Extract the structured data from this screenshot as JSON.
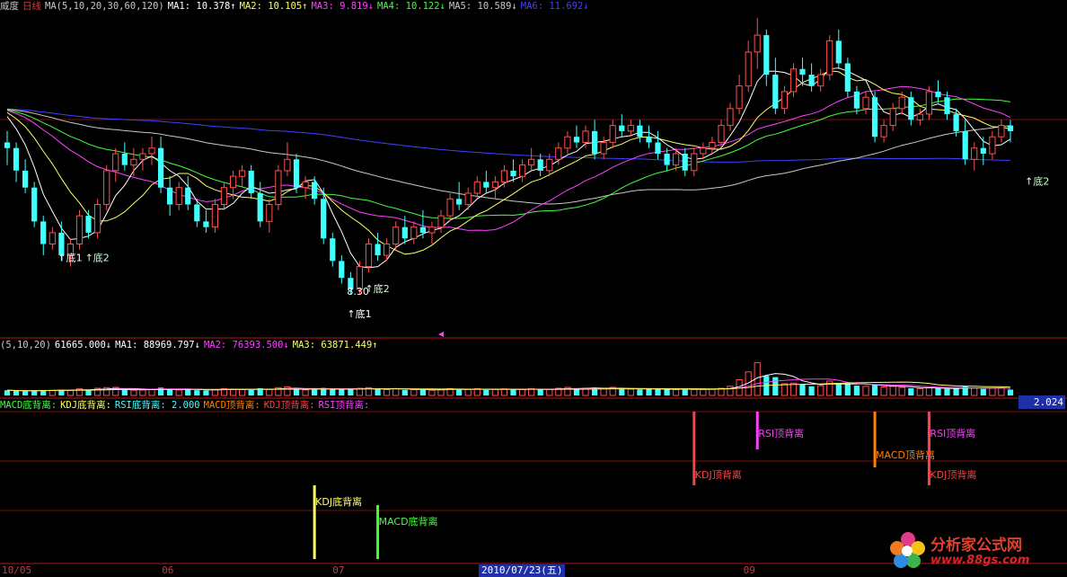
{
  "main_legend": [
    {
      "text": "威度",
      "color": "#c8c8c8"
    },
    {
      "text": "日线",
      "color": "#e83030"
    },
    {
      "text": "MA(5,10,20,30,60,120)",
      "color": "#c8c8c8"
    },
    {
      "text": "MA1: 10.378↑",
      "color": "#ffffff"
    },
    {
      "text": "MA2: 10.105↑",
      "color": "#ffff60"
    },
    {
      "text": "MA3: 9.819↓",
      "color": "#ff40ff"
    },
    {
      "text": "MA4: 10.122↓",
      "color": "#40ff40"
    },
    {
      "text": "MA5: 10.589↓",
      "color": "#c8c8c8"
    },
    {
      "text": "MA6: 11.692↓",
      "color": "#4040ff"
    }
  ],
  "vol_legend": [
    {
      "text": "(5,10,20)",
      "color": "#c8c8c8"
    },
    {
      "text": "61665.000↓",
      "color": "#ffffff"
    },
    {
      "text": "MA1: 88969.797↓",
      "color": "#ffffff"
    },
    {
      "text": "MA2: 76393.500↓",
      "color": "#ff40ff"
    },
    {
      "text": "MA3: 63871.449↑",
      "color": "#ffff60"
    }
  ],
  "sig_legend": [
    {
      "text": "MACD底背离:",
      "color": "#40ff40"
    },
    {
      "text": "KDJ底背离:",
      "color": "#ffff60"
    },
    {
      "text": "RSI底背离: 2.000",
      "color": "#40ffff"
    },
    {
      "text": "MACD顶背离:",
      "color": "#ff8000"
    },
    {
      "text": "KDJ顶背离:",
      "color": "#ff4040"
    },
    {
      "text": "RSI顶背离:",
      "color": "#ff40ff"
    }
  ],
  "signal_value": "2.024",
  "date_ticks": [
    {
      "label": "10/05",
      "pos": 0.0
    },
    {
      "label": "06",
      "pos": 0.15
    },
    {
      "label": "07",
      "pos": 0.31
    },
    {
      "label": "09",
      "pos": 0.695
    }
  ],
  "current_date": "2010/07/23(五)",
  "watermark": {
    "title": "分析家公式网",
    "url": "www.88gs.com"
  },
  "chart_data": {
    "type": "candlestick",
    "price_range": [
      7.6,
      13.3
    ],
    "annotations": [
      {
        "text": "底1",
        "index": 6,
        "price": 8.9
      },
      {
        "text": "底2",
        "index": 9,
        "price": 8.9
      },
      {
        "text": "底1",
        "index": 38,
        "price": 7.9
      },
      {
        "text": "底2",
        "index": 40,
        "price": 8.35
      },
      {
        "text": "底2",
        "index": 113,
        "price": 10.25
      },
      {
        "text": "8.30",
        "index": 38,
        "price": 8.3
      }
    ],
    "candles": [
      [
        11.0,
        11.2,
        10.6,
        10.9
      ],
      [
        10.9,
        11.0,
        10.3,
        10.5
      ],
      [
        10.5,
        10.7,
        10.1,
        10.2
      ],
      [
        10.2,
        10.3,
        9.5,
        9.6
      ],
      [
        9.6,
        9.7,
        9.0,
        9.2
      ],
      [
        9.2,
        9.5,
        9.1,
        9.4
      ],
      [
        9.4,
        9.6,
        8.9,
        9.0
      ],
      [
        9.0,
        9.3,
        8.8,
        9.2
      ],
      [
        9.2,
        9.8,
        9.1,
        9.7
      ],
      [
        9.7,
        9.8,
        9.3,
        9.4
      ],
      [
        9.4,
        10.0,
        9.3,
        9.9
      ],
      [
        9.9,
        10.6,
        9.8,
        10.5
      ],
      [
        10.5,
        10.9,
        10.3,
        10.8
      ],
      [
        10.8,
        11.0,
        10.5,
        10.6
      ],
      [
        10.6,
        10.9,
        10.4,
        10.7
      ],
      [
        10.7,
        10.9,
        10.5,
        10.8
      ],
      [
        10.8,
        11.1,
        10.6,
        10.9
      ],
      [
        10.9,
        11.1,
        10.1,
        10.2
      ],
      [
        10.2,
        10.4,
        9.7,
        9.9
      ],
      [
        9.9,
        10.3,
        9.8,
        10.2
      ],
      [
        10.2,
        10.4,
        9.8,
        9.9
      ],
      [
        9.9,
        10.0,
        9.5,
        9.6
      ],
      [
        9.6,
        9.8,
        9.4,
        9.5
      ],
      [
        9.5,
        10.0,
        9.4,
        9.9
      ],
      [
        9.9,
        10.3,
        9.8,
        10.2
      ],
      [
        10.2,
        10.5,
        10.0,
        10.4
      ],
      [
        10.4,
        10.6,
        10.2,
        10.5
      ],
      [
        10.5,
        10.6,
        10.0,
        10.1
      ],
      [
        10.1,
        10.3,
        9.5,
        9.6
      ],
      [
        9.6,
        10.0,
        9.4,
        9.9
      ],
      [
        9.9,
        10.6,
        9.8,
        10.5
      ],
      [
        10.5,
        11.0,
        10.4,
        10.7
      ],
      [
        10.7,
        10.8,
        10.1,
        10.2
      ],
      [
        10.2,
        10.4,
        10.0,
        10.3
      ],
      [
        10.3,
        10.4,
        9.9,
        10.0
      ],
      [
        10.0,
        10.2,
        9.2,
        9.3
      ],
      [
        9.3,
        9.4,
        8.8,
        8.9
      ],
      [
        8.9,
        9.0,
        8.5,
        8.6
      ],
      [
        8.6,
        8.7,
        8.3,
        8.4
      ],
      [
        8.4,
        8.9,
        8.3,
        8.8
      ],
      [
        8.8,
        9.3,
        8.7,
        9.2
      ],
      [
        9.2,
        9.4,
        8.9,
        9.0
      ],
      [
        9.0,
        9.3,
        8.9,
        9.2
      ],
      [
        9.2,
        9.6,
        9.1,
        9.5
      ],
      [
        9.5,
        9.7,
        9.2,
        9.3
      ],
      [
        9.3,
        9.6,
        9.2,
        9.5
      ],
      [
        9.5,
        9.8,
        9.3,
        9.4
      ],
      [
        9.4,
        9.6,
        9.2,
        9.5
      ],
      [
        9.5,
        9.8,
        9.4,
        9.7
      ],
      [
        9.7,
        10.1,
        9.6,
        10.0
      ],
      [
        10.0,
        10.3,
        9.8,
        9.9
      ],
      [
        9.9,
        10.2,
        9.8,
        10.1
      ],
      [
        10.1,
        10.4,
        10.0,
        10.3
      ],
      [
        10.3,
        10.5,
        10.1,
        10.2
      ],
      [
        10.2,
        10.4,
        10.0,
        10.3
      ],
      [
        10.3,
        10.6,
        10.2,
        10.5
      ],
      [
        10.5,
        10.7,
        10.3,
        10.4
      ],
      [
        10.4,
        10.7,
        10.3,
        10.6
      ],
      [
        10.6,
        10.9,
        10.5,
        10.7
      ],
      [
        10.7,
        10.8,
        10.4,
        10.5
      ],
      [
        10.5,
        10.8,
        10.4,
        10.7
      ],
      [
        10.7,
        11.0,
        10.6,
        10.9
      ],
      [
        10.9,
        11.2,
        10.8,
        11.1
      ],
      [
        11.1,
        11.3,
        10.9,
        11.0
      ],
      [
        11.0,
        11.3,
        10.9,
        11.2
      ],
      [
        11.2,
        11.4,
        10.7,
        10.8
      ],
      [
        10.8,
        11.1,
        10.7,
        11.0
      ],
      [
        11.0,
        11.4,
        10.9,
        11.3
      ],
      [
        11.3,
        11.5,
        11.1,
        11.2
      ],
      [
        11.2,
        11.4,
        11.1,
        11.3
      ],
      [
        11.3,
        11.4,
        11.0,
        11.1
      ],
      [
        11.1,
        11.3,
        10.9,
        11.0
      ],
      [
        11.0,
        11.2,
        10.7,
        10.8
      ],
      [
        10.8,
        10.9,
        10.5,
        10.6
      ],
      [
        10.6,
        10.9,
        10.5,
        10.8
      ],
      [
        10.8,
        10.9,
        10.4,
        10.5
      ],
      [
        10.5,
        10.9,
        10.4,
        10.8
      ],
      [
        10.8,
        11.0,
        10.7,
        10.9
      ],
      [
        10.9,
        11.1,
        10.8,
        11.0
      ],
      [
        11.0,
        11.4,
        10.9,
        11.3
      ],
      [
        11.3,
        11.7,
        11.2,
        11.6
      ],
      [
        11.6,
        12.2,
        11.5,
        12.0
      ],
      [
        12.0,
        12.8,
        11.9,
        12.6
      ],
      [
        12.6,
        13.2,
        12.3,
        12.9
      ],
      [
        12.9,
        13.0,
        12.0,
        12.2
      ],
      [
        12.2,
        12.5,
        11.5,
        11.6
      ],
      [
        11.6,
        12.0,
        11.5,
        11.9
      ],
      [
        11.9,
        12.4,
        11.8,
        12.3
      ],
      [
        12.3,
        12.5,
        12.0,
        12.2
      ],
      [
        12.2,
        12.4,
        11.9,
        12.0
      ],
      [
        12.0,
        12.3,
        11.9,
        12.2
      ],
      [
        12.2,
        12.9,
        12.1,
        12.8
      ],
      [
        12.8,
        13.0,
        12.3,
        12.4
      ],
      [
        12.4,
        12.5,
        11.8,
        11.9
      ],
      [
        11.9,
        12.0,
        11.5,
        11.6
      ],
      [
        11.6,
        11.9,
        11.5,
        11.8
      ],
      [
        11.8,
        11.9,
        11.0,
        11.1
      ],
      [
        11.1,
        11.4,
        11.0,
        11.3
      ],
      [
        11.3,
        11.7,
        11.2,
        11.6
      ],
      [
        11.6,
        11.9,
        11.5,
        11.8
      ],
      [
        11.8,
        11.9,
        11.3,
        11.4
      ],
      [
        11.4,
        11.6,
        11.3,
        11.5
      ],
      [
        11.5,
        12.0,
        11.4,
        11.9
      ],
      [
        11.9,
        12.1,
        11.7,
        11.8
      ],
      [
        11.8,
        11.9,
        11.4,
        11.5
      ],
      [
        11.5,
        11.6,
        11.1,
        11.2
      ],
      [
        11.2,
        11.4,
        10.6,
        10.7
      ],
      [
        10.7,
        11.0,
        10.5,
        10.9
      ],
      [
        10.9,
        11.1,
        10.6,
        10.8
      ],
      [
        10.8,
        11.2,
        10.7,
        11.1
      ],
      [
        11.1,
        11.4,
        11.0,
        11.3
      ],
      [
        11.3,
        11.4,
        11.0,
        11.2
      ]
    ],
    "volume_range": [
      0,
      330000
    ],
    "volumes": [
      40000,
      35000,
      33000,
      38000,
      42000,
      40000,
      45000,
      38000,
      52000,
      40000,
      55000,
      60000,
      62000,
      45000,
      40000,
      42000,
      48000,
      60000,
      50000,
      42000,
      44000,
      40000,
      38000,
      45000,
      52000,
      48000,
      45000,
      42000,
      55000,
      45000,
      60000,
      65000,
      50000,
      42000,
      44000,
      58000,
      52000,
      48000,
      46000,
      55000,
      60000,
      48000,
      45000,
      52000,
      42000,
      44000,
      42000,
      40000,
      45000,
      52000,
      48000,
      45000,
      52000,
      44000,
      46000,
      50000,
      44000,
      48000,
      52000,
      45000,
      48000,
      55000,
      62000,
      50000,
      55000,
      60000,
      52000,
      62000,
      50000,
      48000,
      46000,
      50000,
      52000,
      45000,
      44000,
      48000,
      46000,
      44000,
      48000,
      55000,
      70000,
      120000,
      180000,
      250000,
      150000,
      140000,
      90000,
      95000,
      85000,
      70000,
      75000,
      110000,
      95000,
      90000,
      75000,
      70000,
      80000,
      65000,
      70000,
      62000,
      55000,
      52000,
      58000,
      55000,
      50000,
      52000,
      72000,
      58000,
      50000,
      55000,
      58000,
      45000
    ],
    "signals": [
      {
        "label": "KDJ底背离",
        "index": 34,
        "kind": "KDJ bottom",
        "color": "#ffff60",
        "level": "low"
      },
      {
        "label": "MACD底背离",
        "index": 41,
        "kind": "MACD bottom",
        "color": "#40ff40",
        "level": "low2"
      },
      {
        "label": "KDJ顶背离",
        "index": 76,
        "kind": "KDJ top",
        "color": "#ff4040",
        "level": "high2"
      },
      {
        "label": "RSI顶背离",
        "index": 83,
        "kind": "RSI top",
        "color": "#ff40ff",
        "level": "high1"
      },
      {
        "label": "MACD顶背离",
        "index": 96,
        "kind": "MACD top",
        "color": "#ff8000",
        "level": "high2b"
      },
      {
        "label": "RSI顶背离",
        "index": 102,
        "kind": "RSI top",
        "color": "#ff40ff",
        "level": "high1"
      },
      {
        "label": "KDJ顶背离",
        "index": 102,
        "kind": "KDJ top",
        "color": "#ff4040",
        "level": "high2"
      }
    ],
    "ma_colors": {
      "ma5": "#ffffff",
      "ma10": "#ffff60",
      "ma20": "#ff40ff",
      "ma30": "#40ff40",
      "ma60": "#c8c8c8",
      "ma120": "#4040ff"
    },
    "up_color": "#ff5050",
    "down_color": "#40ffff"
  }
}
